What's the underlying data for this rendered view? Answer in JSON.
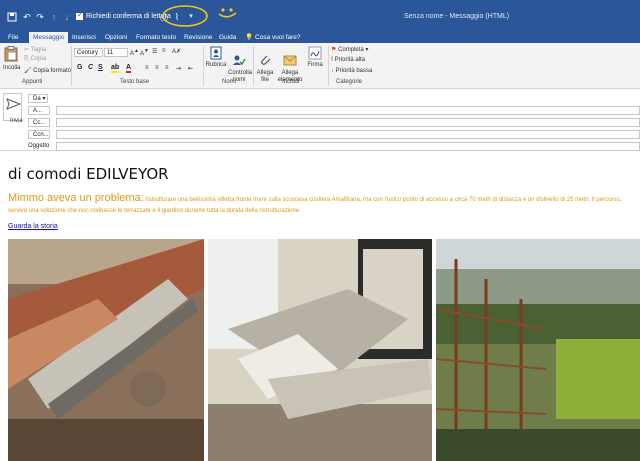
{
  "titlebar": {
    "read_receipt_label": "Richiedi conferma di lettura",
    "read_receipt_checked": true,
    "window_title": "Senza nome  -  Messaggio (HTML)",
    "bg_color": "#2b579a"
  },
  "menu": {
    "items": [
      "File",
      "Messaggio",
      "Inserisci",
      "Opzioni",
      "Formato testo",
      "Revisione",
      "Guida"
    ],
    "active": "Messaggio",
    "tell_me": "Cosa vuoi fare?"
  },
  "ribbon": {
    "clipboard": {
      "paste": "Incolla",
      "cut": "Taglia",
      "copy": "Copia",
      "format_painter": "Copia formato",
      "group": "Appunti"
    },
    "basic_text": {
      "font": "Century",
      "size": "11",
      "group": "Testo base"
    },
    "names": {
      "address_book": "Rubrica",
      "check_names": "Controlla\nnomi",
      "group": "Nomi"
    },
    "include": {
      "attach_file": "Allega\nfile",
      "attach_item": "Allega\nelemento",
      "signature": "Firma",
      "group": "Includi"
    },
    "tags": {
      "follow_up": "Completa",
      "high_priority": "Priorità alta",
      "low_priority": "Priorità bassa",
      "group": "Categorie"
    }
  },
  "headers": {
    "send": "Invia",
    "from_label": "Da",
    "to_label": "A...",
    "cc_label": "Cc...",
    "bcc_label": "Ccn...",
    "subject_label": "Oggetto"
  },
  "body": {
    "brand": "di comodi EDILVEYOR",
    "lead_strong": "Mimmo aveva un problema:",
    "lead_text": " ristrutturare una bellissima villetta fronte mare sulla scoscesa costiera Amalfitana, ma con l'unico punto di accesso a circa 70 metri di distanza e un dislivello di 25 metri. Il percorso, serviva una soluzione che non rovinasse le terrazzate e il giardino durante tutta la durata della ristrutturazione.",
    "story_link": "Guarda la storia",
    "text_color": "#d99a1b",
    "link_color": "#1a0dab"
  }
}
